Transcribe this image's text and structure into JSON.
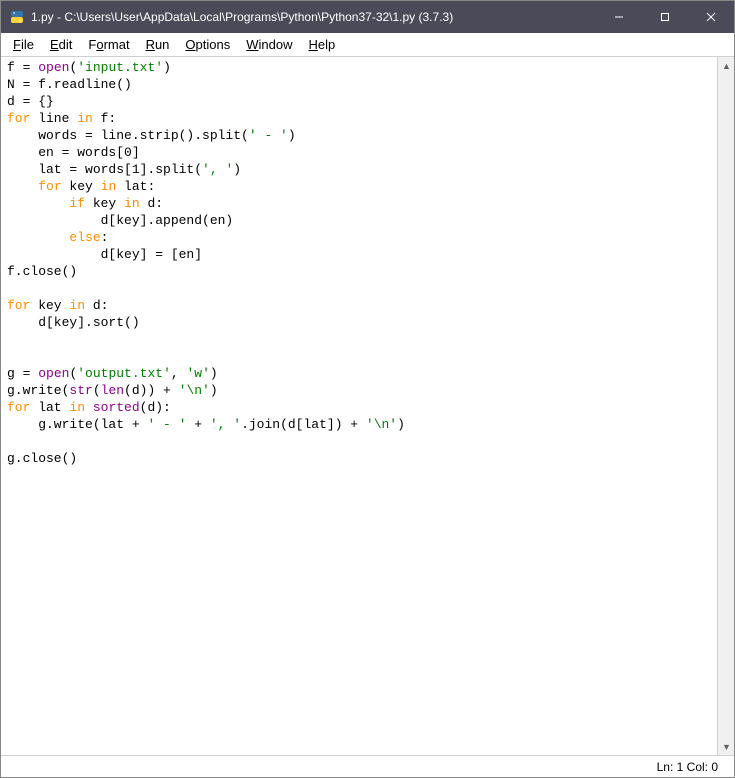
{
  "titlebar": {
    "title": "1.py - C:\\Users\\User\\AppData\\Local\\Programs\\Python\\Python37-32\\1.py (3.7.3)"
  },
  "win_controls": {
    "minimize": "—",
    "maximize": "☐",
    "close": "✕"
  },
  "menu": {
    "file": "File",
    "edit": "Edit",
    "format": "Format",
    "run": "Run",
    "options": "Options",
    "window": "Window",
    "help": "Help"
  },
  "code": {
    "tokens": [
      [
        [
          "plain",
          "f = "
        ],
        [
          "fn",
          "open"
        ],
        [
          "plain",
          "("
        ],
        [
          "str",
          "'input.txt'"
        ],
        [
          "plain",
          ")"
        ]
      ],
      [
        [
          "plain",
          "N = f.readline()"
        ]
      ],
      [
        [
          "plain",
          "d = {}"
        ]
      ],
      [
        [
          "kw",
          "for"
        ],
        [
          "plain",
          " line "
        ],
        [
          "kw",
          "in"
        ],
        [
          "plain",
          " f:"
        ]
      ],
      [
        [
          "plain",
          "    words = line.strip().split("
        ],
        [
          "str",
          "' - '"
        ],
        [
          "plain",
          ")"
        ]
      ],
      [
        [
          "plain",
          "    en = words[0]"
        ]
      ],
      [
        [
          "plain",
          "    lat = words[1].split("
        ],
        [
          "str",
          "', '"
        ],
        [
          "plain",
          ")"
        ]
      ],
      [
        [
          "plain",
          "    "
        ],
        [
          "kw",
          "for"
        ],
        [
          "plain",
          " key "
        ],
        [
          "kw",
          "in"
        ],
        [
          "plain",
          " lat:"
        ]
      ],
      [
        [
          "plain",
          "        "
        ],
        [
          "kw",
          "if"
        ],
        [
          "plain",
          " key "
        ],
        [
          "kw",
          "in"
        ],
        [
          "plain",
          " d:"
        ]
      ],
      [
        [
          "plain",
          "            d[key].append(en)"
        ]
      ],
      [
        [
          "plain",
          "        "
        ],
        [
          "kw",
          "else"
        ],
        [
          "plain",
          ":"
        ]
      ],
      [
        [
          "plain",
          "            d[key] = [en]"
        ]
      ],
      [
        [
          "plain",
          "f.close()"
        ]
      ],
      [
        [
          "plain",
          ""
        ]
      ],
      [
        [
          "kw",
          "for"
        ],
        [
          "plain",
          " key "
        ],
        [
          "kw",
          "in"
        ],
        [
          "plain",
          " d:"
        ]
      ],
      [
        [
          "plain",
          "    d[key].sort()"
        ]
      ],
      [
        [
          "plain",
          ""
        ]
      ],
      [
        [
          "plain",
          ""
        ]
      ],
      [
        [
          "plain",
          "g = "
        ],
        [
          "fn",
          "open"
        ],
        [
          "plain",
          "("
        ],
        [
          "str",
          "'output.txt'"
        ],
        [
          "plain",
          ", "
        ],
        [
          "str",
          "'w'"
        ],
        [
          "plain",
          ")"
        ]
      ],
      [
        [
          "plain",
          "g.write("
        ],
        [
          "fn",
          "str"
        ],
        [
          "plain",
          "("
        ],
        [
          "fn",
          "len"
        ],
        [
          "plain",
          "(d)) + "
        ],
        [
          "str",
          "'\\n'"
        ],
        [
          "plain",
          ")"
        ]
      ],
      [
        [
          "kw",
          "for"
        ],
        [
          "plain",
          " lat "
        ],
        [
          "kw",
          "in"
        ],
        [
          "plain",
          " "
        ],
        [
          "fn",
          "sorted"
        ],
        [
          "plain",
          "(d):"
        ]
      ],
      [
        [
          "plain",
          "    g.write(lat + "
        ],
        [
          "str",
          "' - '"
        ],
        [
          "plain",
          " + "
        ],
        [
          "str",
          "', '"
        ],
        [
          "plain",
          ".join(d[lat]) + "
        ],
        [
          "str",
          "'\\n'"
        ],
        [
          "plain",
          ")"
        ]
      ],
      [
        [
          "plain",
          ""
        ]
      ],
      [
        [
          "plain",
          "g.close()"
        ]
      ]
    ]
  },
  "status": {
    "position": "Ln: 1  Col: 0"
  },
  "colors": {
    "titlebar_bg": "#4a4a58",
    "keyword": "#ff8c00",
    "string": "#008000",
    "builtin": "#900090"
  }
}
